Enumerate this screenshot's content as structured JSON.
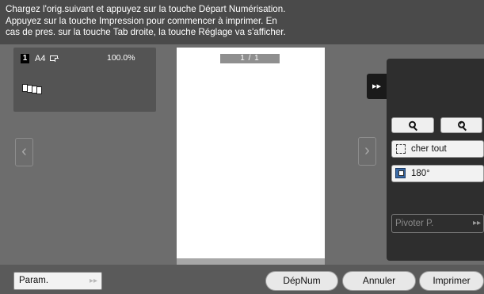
{
  "message": {
    "lines": [
      "Chargez l'orig.suivant et appuyez sur la touche Départ Numérisation.",
      "Appuyez sur la touche Impression pour commencer à imprimer. En",
      "cas de pres. sur la touche Tab droite, la touche Réglage va s'afficher."
    ]
  },
  "thumbnail": {
    "page_number": "1",
    "paper_size": "A4",
    "zoom": "100.0%"
  },
  "preview": {
    "page_counter": "1 / 1"
  },
  "navigation": {
    "left_arrow": "‹",
    "right_arrow": "›",
    "expand_glyph": "▸▸"
  },
  "side_panel": {
    "show_all_label": "cher tout",
    "rotate_180_label": "180°",
    "rotate_page_label": "Pivoter P.",
    "rotate_page_arrow": "▸▸"
  },
  "bottom_bar": {
    "param_label": "Param.",
    "param_arrow": "▸▸",
    "scan_label": "DépNum",
    "cancel_label": "Annuler",
    "print_label": "Imprimer"
  },
  "icons": {
    "zoom_out": "zoom-out-icon",
    "zoom_in": "zoom-in-icon",
    "show_all": "show-all-icon",
    "rotate": "rotate-icon",
    "paper_orientation": "paper-orientation-icon",
    "stacked_pages": "stacked-pages-icon"
  },
  "colors": {
    "screen_background": "#6d6d6d",
    "message_background": "#4a4a4a",
    "side_panel": "#2e2e2e",
    "button_face": "#efefef"
  }
}
